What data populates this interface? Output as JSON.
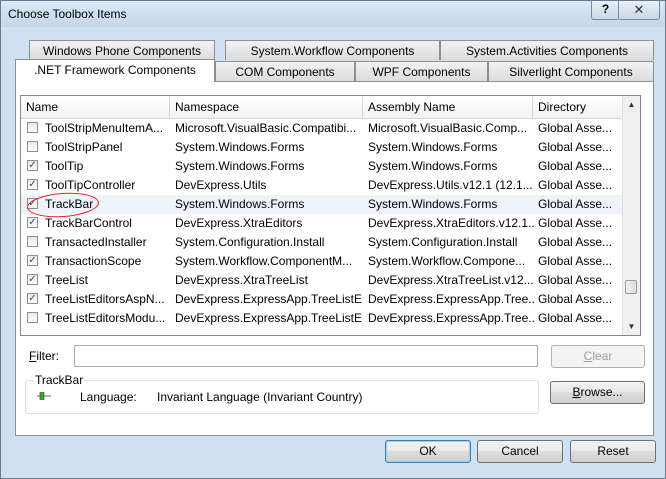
{
  "window": {
    "title": "Choose Toolbox Items",
    "help_label": "?",
    "close_label": "✕"
  },
  "tabs_back": [
    {
      "label": "Windows Phone Components"
    },
    {
      "label": "System.Workflow Components"
    },
    {
      "label": "System.Activities Components"
    }
  ],
  "tabs_front": [
    {
      "label": ".NET Framework Components",
      "active": true
    },
    {
      "label": "COM Components"
    },
    {
      "label": "WPF Components"
    },
    {
      "label": "Silverlight Components"
    }
  ],
  "table": {
    "columns": [
      "Name",
      "Namespace",
      "Assembly Name",
      "Directory"
    ],
    "rows": [
      {
        "checked": false,
        "name": "ToolStripMenuItemA...",
        "namespace": "Microsoft.VisualBasic.Compatibi...",
        "assembly": "Microsoft.VisualBasic.Comp...",
        "directory": "Global Asse..."
      },
      {
        "checked": false,
        "name": "ToolStripPanel",
        "namespace": "System.Windows.Forms",
        "assembly": "System.Windows.Forms",
        "directory": "Global Asse..."
      },
      {
        "checked": true,
        "name": "ToolTip",
        "namespace": "System.Windows.Forms",
        "assembly": "System.Windows.Forms",
        "directory": "Global Asse..."
      },
      {
        "checked": true,
        "name": "ToolTipController",
        "namespace": "DevExpress.Utils",
        "assembly": "DevExpress.Utils.v12.1 (12.1....",
        "directory": "Global Asse..."
      },
      {
        "checked": true,
        "name": "TrackBar",
        "namespace": "System.Windows.Forms",
        "assembly": "System.Windows.Forms",
        "directory": "Global Asse...",
        "selected": true
      },
      {
        "checked": true,
        "name": "TrackBarControl",
        "namespace": "DevExpress.XtraEditors",
        "assembly": "DevExpress.XtraEditors.v12.1...",
        "directory": "Global Asse..."
      },
      {
        "checked": false,
        "name": "TransactedInstaller",
        "namespace": "System.Configuration.Install",
        "assembly": "System.Configuration.Install",
        "directory": "Global Asse..."
      },
      {
        "checked": true,
        "name": "TransactionScope",
        "namespace": "System.Workflow.ComponentM...",
        "assembly": "System.Workflow.Compone...",
        "directory": "Global Asse..."
      },
      {
        "checked": true,
        "name": "TreeList",
        "namespace": "DevExpress.XtraTreeList",
        "assembly": "DevExpress.XtraTreeList.v12....",
        "directory": "Global Asse..."
      },
      {
        "checked": true,
        "name": "TreeListEditorsAspN...",
        "namespace": "DevExpress.ExpressApp.TreeListE...",
        "assembly": "DevExpress.ExpressApp.Tree...",
        "directory": "Global Asse..."
      },
      {
        "checked": false,
        "name": "TreeListEditorsModu...",
        "namespace": "DevExpress.ExpressApp.TreeListE...",
        "assembly": "DevExpress.ExpressApp.Tree...",
        "directory": "Global Asse..."
      }
    ]
  },
  "filter": {
    "label_prefix": "F",
    "label_rest": "ilter:",
    "value": "",
    "clear_label_prefix": "C",
    "clear_label_rest": "lear"
  },
  "details": {
    "group_label": "TrackBar",
    "language_label": "Language:",
    "language_value": "Invariant Language (Invariant Country)",
    "browse_prefix": "B",
    "browse_rest": "rowse..."
  },
  "footer": {
    "ok_label": "OK",
    "cancel_label": "Cancel",
    "reset_label": "Reset"
  },
  "colors": {
    "annotation": "#e01b1b",
    "check": "#2b4b7a"
  }
}
